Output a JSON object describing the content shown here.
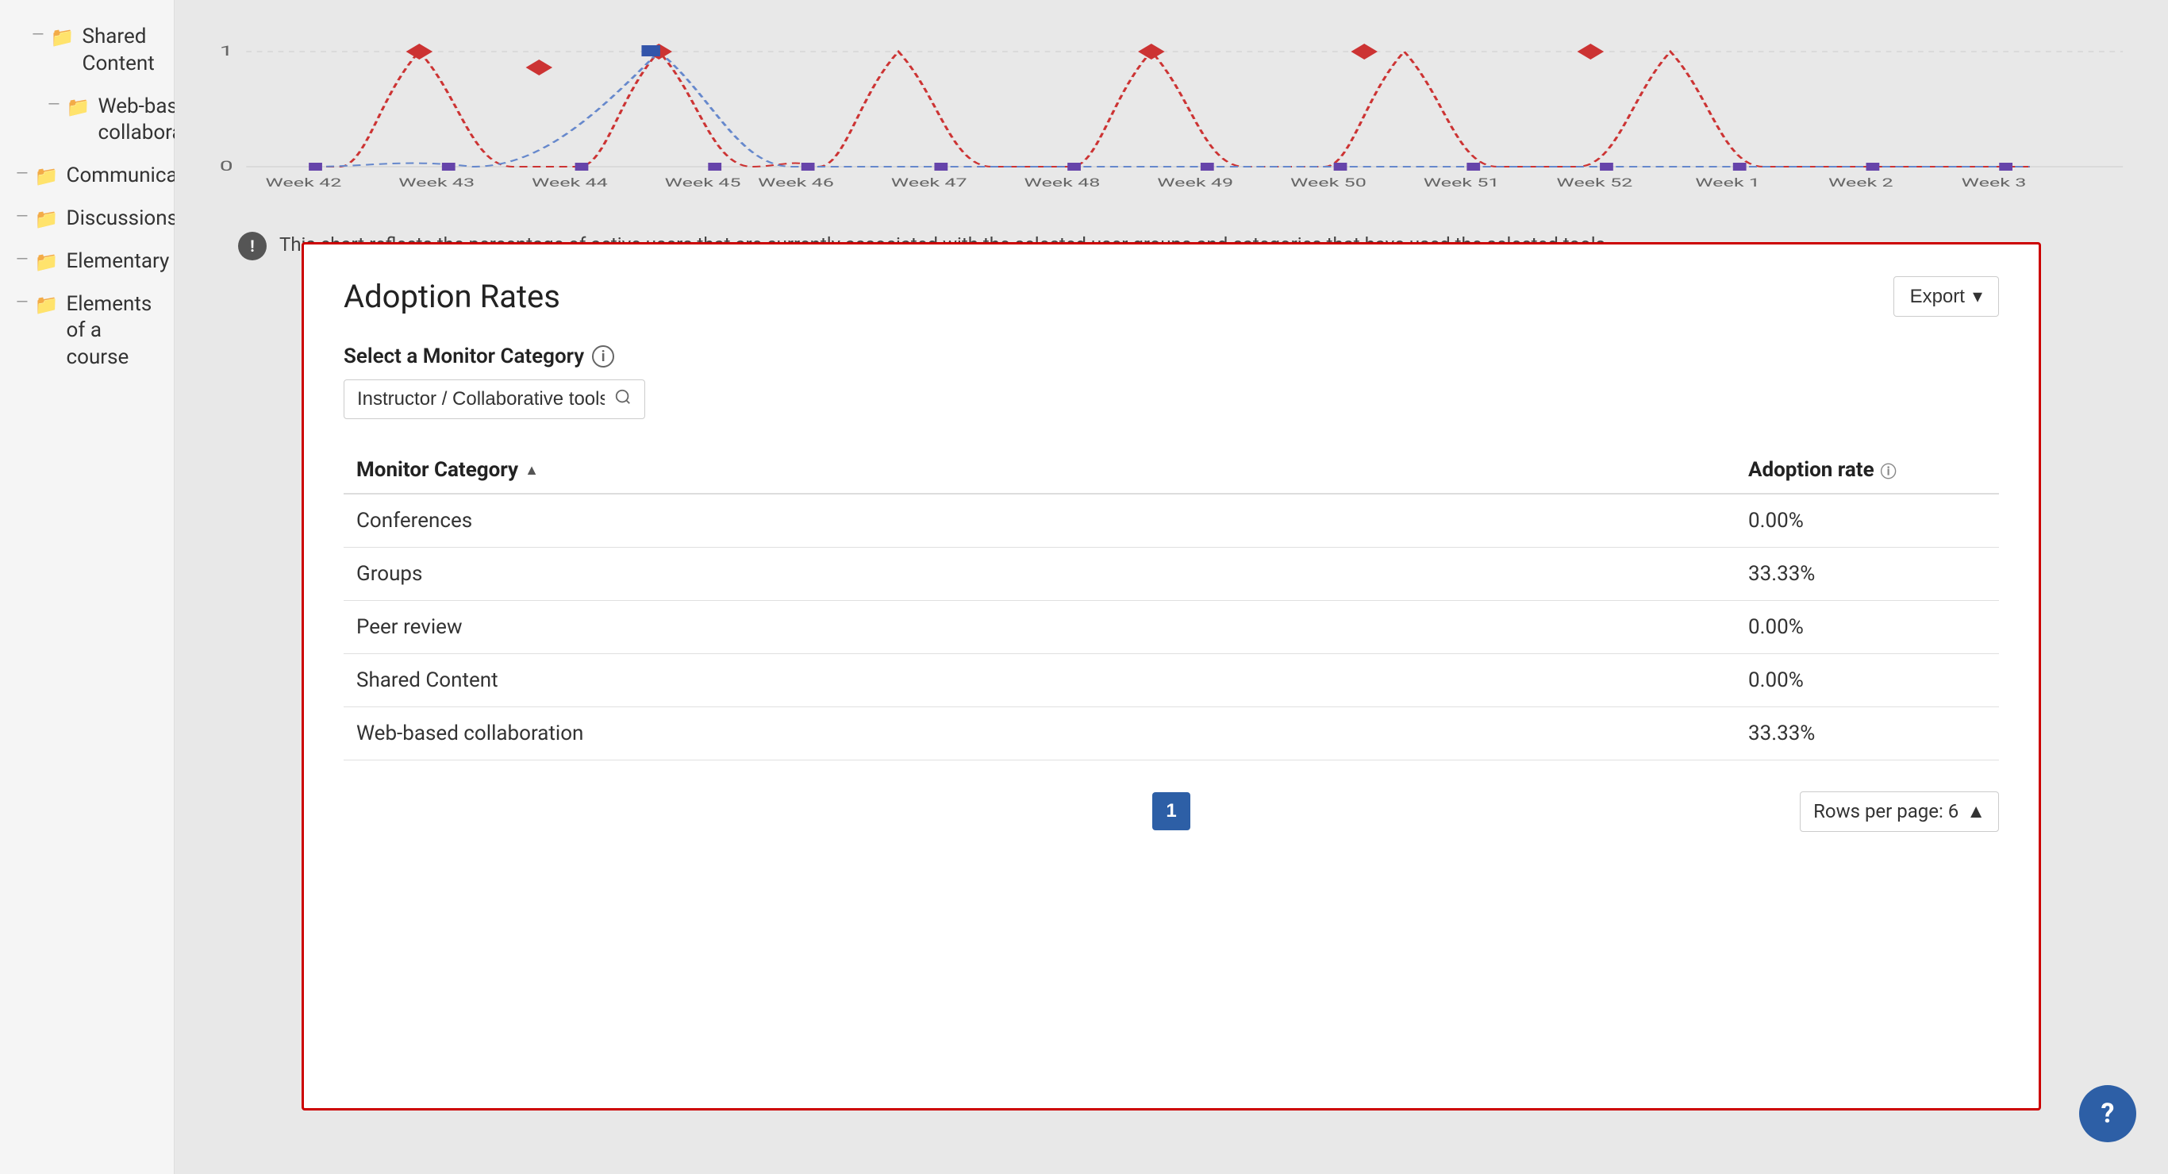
{
  "sidebar": {
    "items": [
      {
        "label": "Shared Content",
        "indented": true,
        "depth": 1
      },
      {
        "label": "Web-based collaboration",
        "indented": true,
        "depth": 2
      },
      {
        "label": "Communication",
        "indented": false,
        "depth": 0
      },
      {
        "label": "Discussions",
        "indented": false,
        "depth": 0
      },
      {
        "label": "Elementary",
        "indented": false,
        "depth": 0
      },
      {
        "label": "Elements of a course",
        "indented": false,
        "depth": 0
      }
    ]
  },
  "chart": {
    "xLabels": [
      "Week 42",
      "Week 43",
      "Week 44",
      "Week 45",
      "Week 46",
      "Week 47",
      "Week 48",
      "Week 49",
      "Week 50",
      "Week 51",
      "Week 52",
      "Week 1",
      "Week 2",
      "Week 3"
    ],
    "yLabels": [
      "0",
      "1"
    ],
    "infoText": "This chart reflects the percentage of active users that are currently associated with the selected user groups and categories that have used the selected tools."
  },
  "adoptionCard": {
    "title": "Adoption Rates",
    "exportLabel": "Export",
    "monitorCategoryLabel": "Select a Monitor Category",
    "searchValue": "Instructor / Collaborative tools",
    "searchPlaceholder": "Instructor / Collaborative tools",
    "tableHeaders": {
      "category": "Monitor Category",
      "sortIndicator": "▲",
      "rate": "Adoption rate",
      "rateInfo": "ⓘ"
    },
    "tableRows": [
      {
        "category": "Conferences",
        "rate": "0.00%"
      },
      {
        "category": "Groups",
        "rate": "33.33%"
      },
      {
        "category": "Peer review",
        "rate": "0.00%"
      },
      {
        "category": "Shared Content",
        "rate": "0.00%"
      },
      {
        "category": "Web-based collaboration",
        "rate": "33.33%"
      }
    ],
    "pagination": {
      "currentPage": "1",
      "rowsPerPageLabel": "Rows per page: 6"
    }
  },
  "help": {
    "label": "?"
  }
}
